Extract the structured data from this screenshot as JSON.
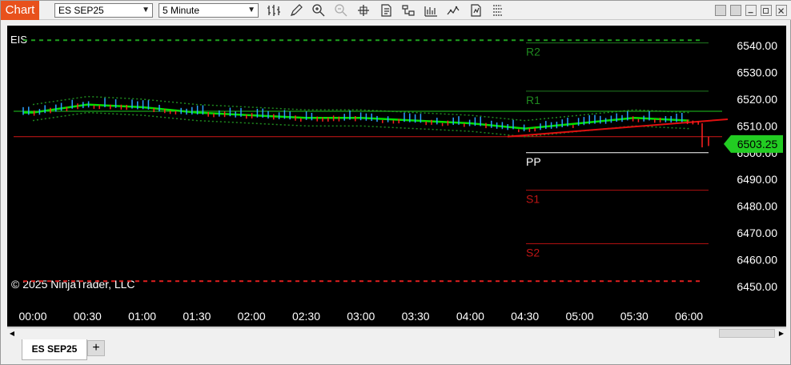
{
  "app": {
    "chart_tab_label": "Chart"
  },
  "toolbar": {
    "instrument": "ES SEP25",
    "interval": "5 Minute",
    "icons": [
      "bar-type-icon",
      "draw-tool-icon",
      "zoom-in-icon",
      "zoom-out-icon",
      "crosshair-icon",
      "data-box-icon",
      "strategies-icon",
      "indicators-icon",
      "chart-trader-icon",
      "properties-icon",
      "snapshot-icon"
    ]
  },
  "chart": {
    "instrument_label": "EIS",
    "copyright": "© 2025 NinjaTrader, LLC",
    "current_price_label": "6503.25",
    "colors": {
      "background": "#000000",
      "up": "#2aa0ff",
      "down": "#ff2020",
      "ma": "#00e000",
      "band": "#1e8a1e",
      "pivot_resistance": "#1f7a1f",
      "pivot_support": "#b01010",
      "price_marker": "#22cc22"
    },
    "pivot_labels": [
      "R2",
      "R1",
      "PP",
      "S1",
      "S2"
    ],
    "y_ticks": [
      "6540.00",
      "6530.00",
      "6520.00",
      "6510.00",
      "6500.00",
      "6490.00",
      "6480.00",
      "6470.00",
      "6460.00",
      "6450.00"
    ],
    "x_ticks": [
      "00:00",
      "00:30",
      "01:00",
      "01:30",
      "02:00",
      "02:30",
      "03:00",
      "03:30",
      "04:00",
      "04:30",
      "05:00",
      "05:30",
      "06:00"
    ]
  },
  "chart_data": {
    "type": "line",
    "title": "",
    "instrument": "ES SEP25",
    "xlabel": "",
    "ylabel": "",
    "ylim": [
      6446,
      6548
    ],
    "x": [
      "00:00",
      "00:30",
      "01:00",
      "01:30",
      "02:00",
      "02:30",
      "03:00",
      "03:30",
      "04:00",
      "04:30",
      "05:00",
      "05:30",
      "06:00"
    ],
    "series": [
      {
        "name": "",
        "values": [
          6515,
          6518,
          6517,
          6515,
          6514,
          6513,
          6513,
          6512,
          6511,
          6509,
          6511,
          6513,
          6512
        ]
      }
    ],
    "pivots": {
      "R2": 6541,
      "R1": 6523,
      "PP": 6500,
      "S1": 6486,
      "S2": 6466
    },
    "levels": {
      "upper_dashed": 6542,
      "lower_dashed": 6452,
      "red_line": 6506
    },
    "last_price": 6503.25,
    "grid": false,
    "legend": "none"
  }
}
